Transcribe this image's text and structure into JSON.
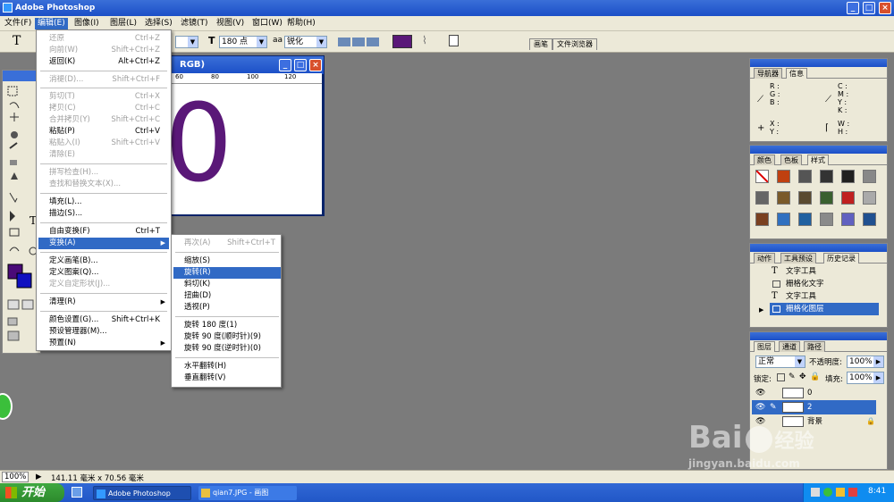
{
  "app": {
    "title": "Adobe Photoshop"
  },
  "menubar": {
    "items": [
      "文件(F)",
      "编辑(E)",
      "图像(I)",
      "图层(L)",
      "选择(S)",
      "滤镜(T)",
      "视图(V)",
      "窗口(W)",
      "帮助(H)"
    ]
  },
  "options": {
    "tool_glyph": "T",
    "font_size": "180 点",
    "aa_label": "aa",
    "aa_value": "锐化",
    "color": "#5a1878",
    "tabs": [
      "画笔",
      "文件浏览器"
    ]
  },
  "document": {
    "title": "RGB)",
    "content_glyph": "0",
    "ruler_labels": [
      "60",
      "80",
      "100",
      "120"
    ],
    "text_color": "#5a1878"
  },
  "edit_menu": {
    "items": [
      {
        "label": "还原",
        "shortcut": "Ctrl+Z",
        "disabled": true
      },
      {
        "label": "向前(W)",
        "shortcut": "Shift+Ctrl+Z",
        "disabled": true
      },
      {
        "label": "返回(K)",
        "shortcut": "Alt+Ctrl+Z",
        "disabled": false
      },
      {
        "label": "消褪(D)...",
        "shortcut": "Shift+Ctrl+F",
        "disabled": true
      },
      {
        "label": "剪切(T)",
        "shortcut": "Ctrl+X",
        "disabled": true
      },
      {
        "label": "拷贝(C)",
        "shortcut": "Ctrl+C",
        "disabled": true
      },
      {
        "label": "合并拷贝(Y)",
        "shortcut": "Shift+Ctrl+C",
        "disabled": true
      },
      {
        "label": "粘贴(P)",
        "shortcut": "Ctrl+V",
        "disabled": false
      },
      {
        "label": "粘贴入(I)",
        "shortcut": "Shift+Ctrl+V",
        "disabled": true
      },
      {
        "label": "清除(E)",
        "shortcut": "",
        "disabled": true
      },
      {
        "label": "拼写检查(H)...",
        "shortcut": "",
        "disabled": true
      },
      {
        "label": "查找和替换文本(X)...",
        "shortcut": "",
        "disabled": true
      },
      {
        "label": "填充(L)...",
        "shortcut": "",
        "disabled": false
      },
      {
        "label": "描边(S)...",
        "shortcut": "",
        "disabled": false
      },
      {
        "label": "自由变换(F)",
        "shortcut": "Ctrl+T",
        "disabled": false
      },
      {
        "label": "变换(A)",
        "shortcut": "",
        "disabled": false
      },
      {
        "label": "定义画笔(B)...",
        "shortcut": "",
        "disabled": false
      },
      {
        "label": "定义图案(Q)...",
        "shortcut": "",
        "disabled": false
      },
      {
        "label": "定义自定形状(J)...",
        "shortcut": "",
        "disabled": true
      },
      {
        "label": "清理(R)",
        "shortcut": "",
        "disabled": false
      },
      {
        "label": "颜色设置(G)...",
        "shortcut": "Shift+Ctrl+K",
        "disabled": false
      },
      {
        "label": "预设管理器(M)...",
        "shortcut": "",
        "disabled": false
      },
      {
        "label": "预置(N)",
        "shortcut": "",
        "disabled": false
      }
    ]
  },
  "transform_menu": {
    "items": [
      {
        "label": "再次(A)",
        "shortcut": "Shift+Ctrl+T",
        "disabled": true
      },
      {
        "label": "缩放(S)",
        "disabled": false
      },
      {
        "label": "旋转(R)",
        "disabled": false
      },
      {
        "label": "斜切(K)",
        "disabled": false
      },
      {
        "label": "扭曲(D)",
        "disabled": false
      },
      {
        "label": "透视(P)",
        "disabled": false
      },
      {
        "label": "旋转 180 度(1)",
        "disabled": false
      },
      {
        "label": "旋转 90 度(顺时针)(9)",
        "disabled": false
      },
      {
        "label": "旋转 90 度(逆时针)(0)",
        "disabled": false
      },
      {
        "label": "水平翻转(H)",
        "disabled": false
      },
      {
        "label": "垂直翻转(V)",
        "disabled": false
      }
    ]
  },
  "navigator": {
    "tabs": [
      "导航器",
      "信息"
    ],
    "rgb": "R :\nG :\nB :",
    "cmyk": "C :\nM :\nY :\nK :",
    "xy": "X :\nY :",
    "wh": "W :\nH :"
  },
  "swatches": {
    "tabs": [
      "颜色",
      "色板",
      "样式"
    ],
    "colors": [
      "#ffffff",
      "#c04010",
      "#555555",
      "#333333",
      "#202020",
      "#888888",
      "#666666",
      "#7a5a2a",
      "#5a4a30",
      "#3a6030",
      "#c02020",
      "#aaaaaa",
      "#7a4020",
      "#3070c0",
      "#2060a0",
      "#8a8a8a",
      "#6060c0",
      "#205090"
    ]
  },
  "history": {
    "tabs": [
      "动作",
      "工具预设",
      "历史记录"
    ],
    "items": [
      "文字工具",
      "栅格化文字",
      "文字工具",
      "栅格化图层"
    ]
  },
  "layers": {
    "tabs": [
      "图层",
      "通道",
      "路径"
    ],
    "blend": "正常",
    "opacity_label": "不透明度:",
    "opacity": "100%",
    "lock_label": "锁定:",
    "fill_label": "填充:",
    "fill": "100%",
    "rows": [
      {
        "name": "0"
      },
      {
        "name": "2"
      },
      {
        "name": "背景"
      }
    ]
  },
  "status": {
    "zoom": "100%",
    "size": "141.11 毫米 x 70.56 毫米"
  },
  "taskbar": {
    "start": "开始",
    "tasks": [
      "Adobe Photoshop",
      "qian7.JPG - 画图"
    ],
    "clock": "8:41"
  },
  "watermark": {
    "brand": "Bai",
    "brand2": "经验",
    "url": "jingyan.baidu.com"
  }
}
